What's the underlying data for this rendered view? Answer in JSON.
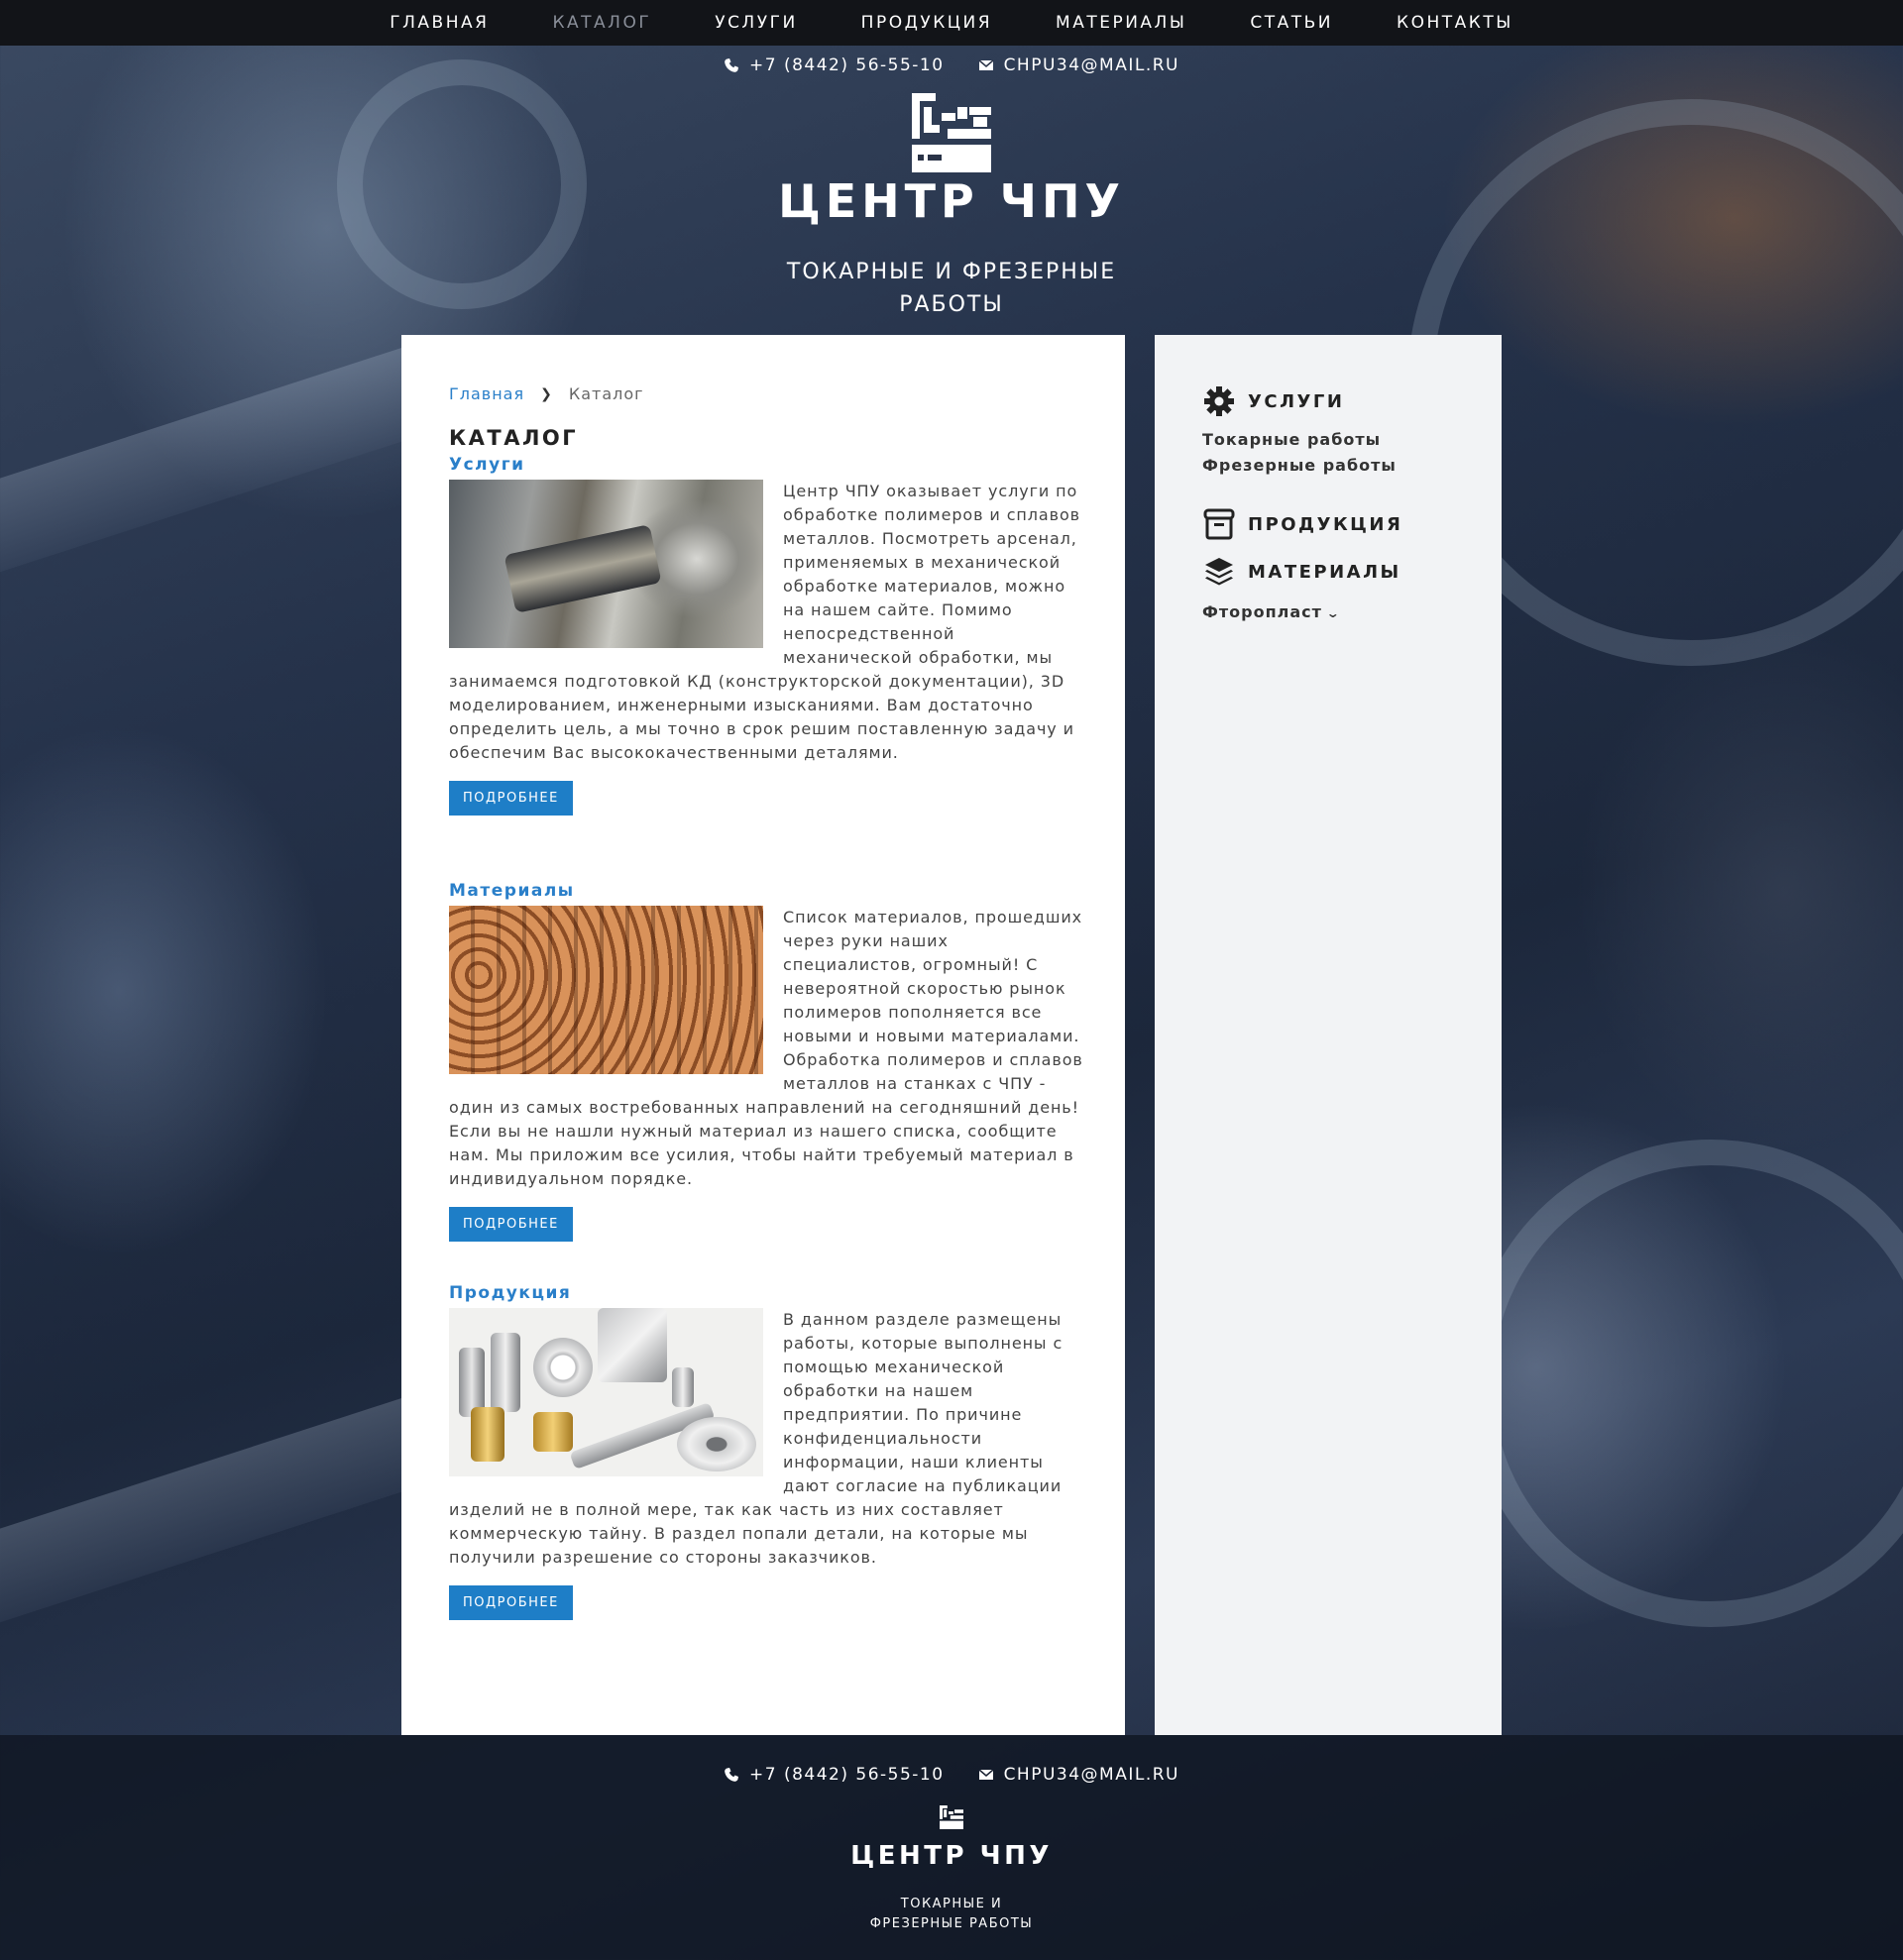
{
  "nav": {
    "items": [
      {
        "label": "ГЛАВНАЯ"
      },
      {
        "label": "КАТАЛОГ"
      },
      {
        "label": "УСЛУГИ"
      },
      {
        "label": "ПРОДУКЦИЯ"
      },
      {
        "label": "МАТЕРИАЛЫ"
      },
      {
        "label": "СТАТЬИ"
      },
      {
        "label": "КОНТАКТЫ"
      }
    ],
    "active": "КАТАЛОГ"
  },
  "header": {
    "phone": "+7 (8442) 56-55-10",
    "email": "CHPU34@MAIL.RU",
    "phone_icon": "phone-icon",
    "email_icon": "envelope-icon",
    "logo_icon": "cnc-logo-icon",
    "title": "ЦЕНТР ЧПУ",
    "subtitle": "ТОКАРНЫЕ И ФРЕЗЕРНЫЕ РАБОТЫ"
  },
  "breadcrumb": {
    "home": "Главная",
    "current": "Каталог",
    "separator_icon": "chevron-right-icon"
  },
  "main": {
    "page_title": "КАТАЛОГ",
    "sections": [
      {
        "title": "Услуги",
        "image_icon": "lathe-photo",
        "text": "Центр ЧПУ оказывает услуги по обработке полимеров и сплавов металлов. Посмотреть арсенал, применяемых в механической обработке материалов, можно на нашем сайте. Помимо непосредственной механической обработки, мы занимаемся подготовкой КД (конструкторской документации), 3D моделированием, инженерными изысканиями. Вам достаточно определить цель, а мы точно в срок решим поставленную задачу и обеспечим Вас высококачественными деталями.",
        "button": "ПОДРОБНЕЕ"
      },
      {
        "title": "Материалы",
        "image_icon": "metal-bars-photo",
        "text": "Список материалов, прошедших через руки наших специалистов, огромный! С невероятной скоростью рынок полимеров пополняется все новыми и новыми материалами. Обработка полимеров и сплавов металлов на станках с ЧПУ - один из самых востребованных направлений на сегодняшний день! Если вы не нашли нужный материал из нашего списка, сообщите нам. Мы приложим все усилия, чтобы найти требуемый материал в индивидуальном порядке.",
        "button": "ПОДРОБНЕЕ"
      },
      {
        "title": "Продукция",
        "image_icon": "machined-parts-photo",
        "text": "В данном разделе размещены работы, которые выполнены с помощью механической обработки на нашем предприятии. По причине конфиденциальности информации, наши клиенты дают согласие на публикации изделий не в полной мере, так как часть из них составляет коммерческую тайну. В раздел попали детали, на которые мы получили разрешение со стороны заказчиков.",
        "button": "ПОДРОБНЕЕ"
      }
    ]
  },
  "sidebar": {
    "services": {
      "label": "УСЛУГИ",
      "icon": "gear-icon",
      "links": [
        "Токарные работы",
        "Фрезерные работы"
      ]
    },
    "products": {
      "label": "ПРОДУКЦИЯ",
      "icon": "box-icon"
    },
    "materials": {
      "label": "МАТЕРИАЛЫ",
      "icon": "layers-icon",
      "links": [
        "Фторопласт"
      ],
      "dropdown_icon": "chevron-down-icon"
    }
  },
  "footer": {
    "phone": "+7 (8442) 56-55-10",
    "email": "CHPU34@MAIL.RU",
    "title": "ЦЕНТР ЧПУ",
    "subtitle": "ТОКАРНЫЕ И ФРЕЗЕРНЫЕ РАБОТЫ"
  },
  "colors": {
    "accent": "#1e7ec7",
    "link": "#2a7fc9",
    "nav_bg": "#121418",
    "sidebar_bg": "#f2f3f5"
  }
}
